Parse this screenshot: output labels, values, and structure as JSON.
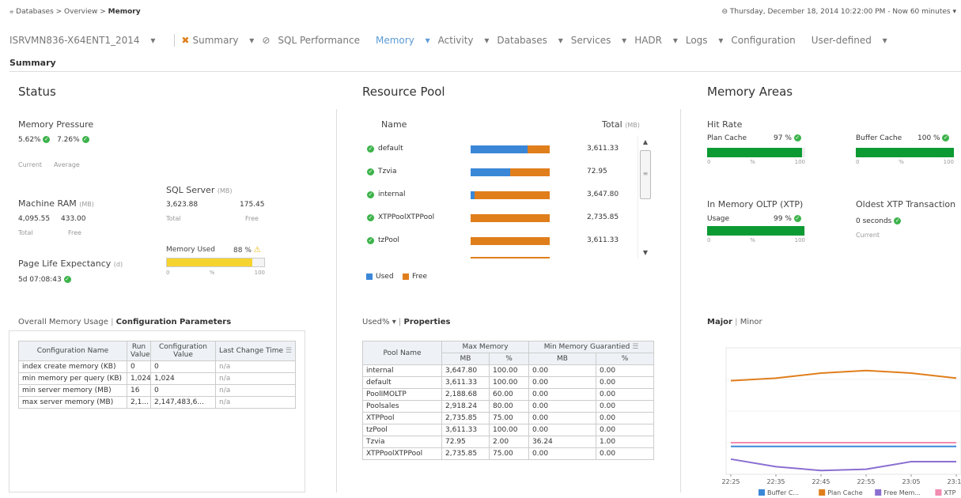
{
  "breadcrumb": {
    "icon": "databases-icon",
    "path": "Databases > Overview > ",
    "current": "Memory"
  },
  "datetime": "Thursday, December 18, 2014 10:22:00 PM - Now 60 minutes",
  "server": "ISRVMN836-X64ENT1_2014",
  "nav": [
    "Summary",
    "SQL Performance",
    "Memory",
    "Activity",
    "Databases",
    "Services",
    "HADR",
    "Logs",
    "Configuration",
    "User-defined"
  ],
  "section_title": "Summary",
  "status": {
    "title": "Status",
    "mem_pressure_label": "Memory Pressure",
    "mem_current": "5.62%",
    "mem_average": "7.26%",
    "current_label": "Current",
    "average_label": "Average",
    "machine_ram_label": "Machine RAM",
    "mb_unit": "(MB)",
    "ram_total": "4,095.55",
    "ram_free": "433.00",
    "total_label": "Total",
    "free_label": "Free",
    "sql_server_label": "SQL Server",
    "sql_total": "3,623.88",
    "sql_free": "175.45",
    "memory_used_label": "Memory Used",
    "memory_used_value": "88 %",
    "memory_used_fraction": 0.88,
    "scale": [
      "0",
      "%",
      "100"
    ],
    "ple_label": "Page Life Expectancy",
    "ple_unit": "(d)",
    "ple_value": "5d 07:08:43",
    "tabs": [
      "Overall Memory Usage",
      "Configuration Parameters"
    ],
    "config_headers": [
      "Configuration Name",
      "Run Value",
      "Configuration Value",
      "Last Change Time"
    ],
    "config_rows": [
      [
        "index create memory (KB)",
        "0",
        "0",
        "n/a"
      ],
      [
        "min memory per query (KB)",
        "1,024",
        "1,024",
        "n/a"
      ],
      [
        "min server memory (MB)",
        "16",
        "0",
        "n/a"
      ],
      [
        "max server memory (MB)",
        "2,1...",
        "2,147,483,6...",
        "n/a"
      ]
    ]
  },
  "pool": {
    "title": "Resource Pool",
    "name_header": "Name",
    "total_header": "Total",
    "mb_unit": "(MB)",
    "rows": [
      {
        "name": "default",
        "total": "3,611.33",
        "used": 0.72
      },
      {
        "name": "Tzvia",
        "total": "72.95",
        "used": 0.5
      },
      {
        "name": "internal",
        "total": "3,647.80",
        "used": 0.05
      },
      {
        "name": "XTPPoolXTPPool",
        "total": "2,735.85",
        "used": 0
      },
      {
        "name": "tzPool",
        "total": "3,611.33",
        "used": 0
      }
    ],
    "legend_used": "Used",
    "legend_free": "Free",
    "color_used": "#3a87d8",
    "color_free": "#e07e1c",
    "tabs": [
      "Used%",
      "Properties"
    ],
    "table_headers": [
      "Pool Name",
      "Max Memory",
      "Min Memory Guarantied"
    ],
    "sub_headers": [
      "MB",
      "%",
      "MB",
      "%"
    ],
    "table_rows": [
      [
        "internal",
        "3,647.80",
        "100.00",
        "0.00",
        "0.00"
      ],
      [
        "default",
        "3,611.33",
        "100.00",
        "0.00",
        "0.00"
      ],
      [
        "PoolIMOLTP",
        "2,188.68",
        "60.00",
        "0.00",
        "0.00"
      ],
      [
        "Poolsales",
        "2,918.24",
        "80.00",
        "0.00",
        "0.00"
      ],
      [
        "XTPPool",
        "2,735.85",
        "75.00",
        "0.00",
        "0.00"
      ],
      [
        "tzPool",
        "3,611.33",
        "100.00",
        "0.00",
        "0.00"
      ],
      [
        "Tzvia",
        "72.95",
        "2.00",
        "36.24",
        "1.00"
      ],
      [
        "XTPPoolXTPPool",
        "2,735.85",
        "75.00",
        "0.00",
        "0.00"
      ]
    ]
  },
  "areas": {
    "title": "Memory Areas",
    "hit_rate_label": "Hit Rate",
    "plan_cache_label": "Plan Cache",
    "plan_cache_value": "97 %",
    "plan_cache_fraction": 0.97,
    "buffer_cache_label": "Buffer Cache",
    "buffer_cache_value": "100 %",
    "buffer_cache_fraction": 1.0,
    "oltp_label": "In Memory OLTP (XTP)",
    "usage_label": "Usage",
    "usage_value": "99 %",
    "usage_fraction": 0.99,
    "oldest_label": "Oldest XTP Transaction",
    "oldest_value": "0 seconds",
    "current_label": "Current",
    "scale": [
      "0",
      "%",
      "100"
    ],
    "chart_tabs": [
      "Major",
      "Minor"
    ]
  },
  "chart_data": {
    "type": "line",
    "x": [
      "22:25",
      "22:35",
      "22:45",
      "22:55",
      "23:05",
      "23:15"
    ],
    "series": [
      {
        "name": "Buffer C...",
        "color": "#3a87d8",
        "values": [
          0.22,
          0.22,
          0.22,
          0.22,
          0.22,
          0.22
        ]
      },
      {
        "name": "Plan Cache",
        "color": "#e07e1c",
        "values": [
          0.74,
          0.76,
          0.8,
          0.82,
          0.8,
          0.76
        ]
      },
      {
        "name": "Free Mem...",
        "color": "#8a6fd1",
        "values": [
          0.12,
          0.06,
          0.03,
          0.04,
          0.1,
          0.1
        ]
      },
      {
        "name": "XTP",
        "color": "#f28cb0",
        "values": [
          0.25,
          0.25,
          0.25,
          0.25,
          0.25,
          0.25
        ]
      }
    ],
    "ylim": [
      0,
      1
    ],
    "legend": "bottom"
  }
}
